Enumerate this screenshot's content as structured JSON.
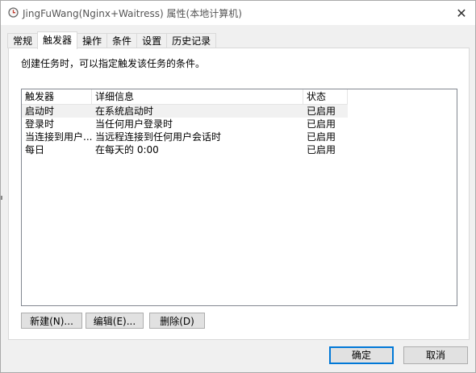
{
  "window": {
    "title": "JingFuWang(Nginx+Waitress) 属性(本地计算机)",
    "close_glyph": "✕"
  },
  "tabs": [
    {
      "label": "常规",
      "active": false
    },
    {
      "label": "触发器",
      "active": true
    },
    {
      "label": "操作",
      "active": false
    },
    {
      "label": "条件",
      "active": false
    },
    {
      "label": "设置",
      "active": false
    },
    {
      "label": "历史记录",
      "active": false
    }
  ],
  "panel": {
    "description": "创建任务时，可以指定触发该任务的条件。"
  },
  "table": {
    "columns": [
      "触发器",
      "详细信息",
      "状态"
    ],
    "rows": [
      [
        "启动时",
        "在系统启动时",
        "已启用"
      ],
      [
        "登录时",
        "当任何用户登录时",
        "已启用"
      ],
      [
        "当连接到用户...",
        "当远程连接到任何用户会话时",
        "已启用"
      ],
      [
        "每日",
        "在每天的 0:00",
        "已启用"
      ]
    ],
    "selected_row": 0
  },
  "buttons": {
    "new": "新建(N)...",
    "edit": "编辑(E)...",
    "delete": "删除(D)",
    "ok": "确定",
    "cancel": "取消"
  },
  "colors": {
    "accent": "#0078d7",
    "selected_row": "#f1f1f1"
  },
  "icons": {
    "title": "clock-icon",
    "close": "close-icon"
  }
}
